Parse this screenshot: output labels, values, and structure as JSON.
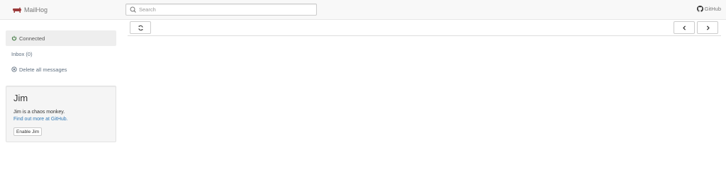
{
  "app": {
    "brand": "MailHog",
    "github_label": "GitHub"
  },
  "search": {
    "placeholder": "Search",
    "value": ""
  },
  "sidebar": {
    "status": "Connected",
    "inbox": "Inbox (0)",
    "delete_all": "Delete all messages"
  },
  "jim": {
    "title": "Jim",
    "description": "Jim is a chaos monkey.",
    "link": "Find out more at GitHub.",
    "button": "Enable Jim"
  },
  "icons": {
    "brand": "pig-logo-icon",
    "search": "search-icon",
    "github": "github-icon",
    "status": "power-icon",
    "delete": "delete-circle-icon",
    "refresh": "refresh-icon",
    "prev": "chevron-left-icon",
    "next": "chevron-right-icon"
  },
  "colors": {
    "brand_logo": "#9b3a3a",
    "connected": "#3c763d",
    "link": "#337ab7",
    "navbar_bg": "#f8f8f8"
  }
}
